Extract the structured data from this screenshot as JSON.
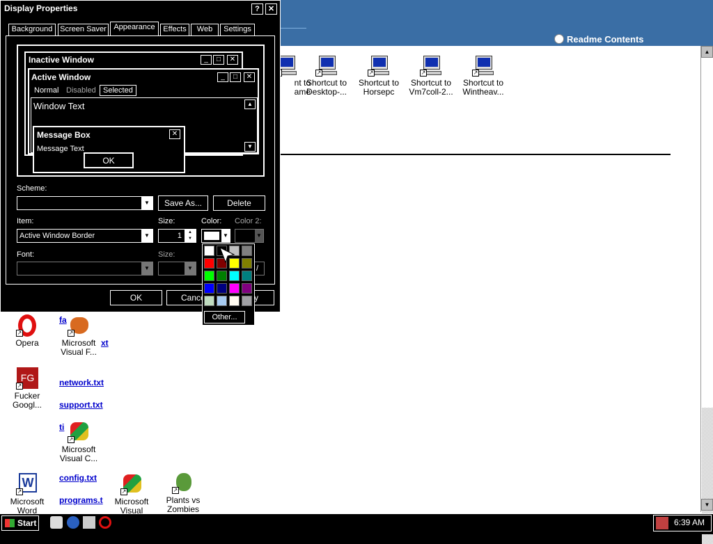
{
  "background_window": {
    "readme_link": "Readme Contents"
  },
  "desktop_icons_top": [
    {
      "label1": "nt to",
      "label2": "ame"
    },
    {
      "label1": "Shortcut to",
      "label2": "Desktop-..."
    },
    {
      "label1": "Shortcut to",
      "label2": "Horsepc"
    },
    {
      "label1": "Shortcut to",
      "label2": "Vm7coll-2..."
    },
    {
      "label1": "Shortcut to",
      "label2": "Wintheav..."
    }
  ],
  "desktop_icons_left": [
    {
      "label1": "Opera",
      "label2": ""
    },
    {
      "label1": "Microsoft",
      "label2": "Visual F..."
    },
    {
      "label1": "Fucker",
      "label2": "Googl..."
    },
    {
      "label1": "Microsoft",
      "label2": "Visual C..."
    },
    {
      "label1": "Microsoft",
      "label2": "Word"
    },
    {
      "label1": "Microsoft",
      "label2": "Visual"
    },
    {
      "label1": "Plants vs",
      "label2": "Zombies"
    }
  ],
  "text_links": [
    "fa",
    "xt",
    "network.txt",
    "support.txt",
    "ti",
    "config.txt",
    "programs.t"
  ],
  "dialog": {
    "title": "Display Properties",
    "help_button": "?",
    "close_button": "✕",
    "tabs": [
      "Background",
      "Screen Saver",
      "Appearance",
      "Effects",
      "Web",
      "Settings"
    ],
    "active_tab": "Appearance",
    "preview": {
      "inactive_title": "Inactive Window",
      "active_title": "Active Window",
      "menu_normal": "Normal",
      "menu_disabled": "Disabled",
      "menu_selected": "Selected",
      "window_text": "Window Text",
      "msgbox_title": "Message Box",
      "msgbox_text": "Message Text",
      "msgbox_ok": "OK"
    },
    "scheme_label": "Scheme:",
    "scheme_value": "",
    "save_as": "Save As...",
    "delete": "Delete",
    "item_label": "Item:",
    "item_value": "Active Window Border",
    "size_label": "Size:",
    "size_value": "1",
    "color_label": "Color:",
    "color2_label": "Color 2:",
    "font_label": "Font:",
    "font_value": "",
    "font_size_label": "Size:",
    "ok": "OK",
    "cancel": "Cance",
    "apply_fragment": "y",
    "other_button": "Other..."
  },
  "color_swatches": [
    "#ffffff",
    "#000000",
    "#c0c0c0",
    "#808080",
    "#ff0000",
    "#800000",
    "#ffff00",
    "#808000",
    "#00ff00",
    "#008000",
    "#00ffff",
    "#008080",
    "#0000ff",
    "#000080",
    "#ff00ff",
    "#800080",
    "#c0dcc0",
    "#a6caf0",
    "#fffbf0",
    "#a0a0a4"
  ],
  "taskbar": {
    "start": "Start",
    "clock": "6:39 AM"
  },
  "colors": {
    "browser_header": "#3a6ea5",
    "link": "#0000cc"
  }
}
